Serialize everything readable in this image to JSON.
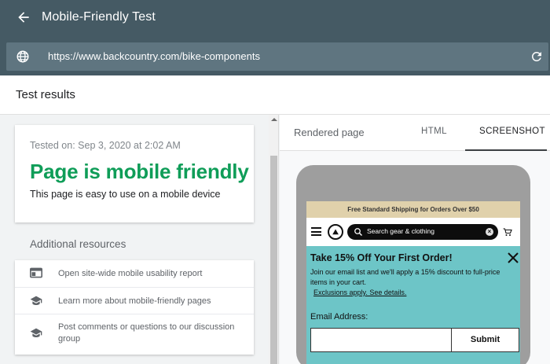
{
  "app": {
    "title": "Mobile-Friendly Test",
    "url": "https://www.backcountry.com/bike-components"
  },
  "results": {
    "header": "Test results",
    "tested_on": "Tested on: Sep 3, 2020 at 2:02 AM",
    "status": "Page is mobile friendly",
    "status_color": "#0f9d58",
    "subtitle": "This page is easy to use on a mobile device"
  },
  "resources": {
    "heading": "Additional resources",
    "items": [
      {
        "icon": "browser-window-icon",
        "label": "Open site-wide mobile usability report"
      },
      {
        "icon": "graduation-cap-icon",
        "label": "Learn more about mobile-friendly pages"
      },
      {
        "icon": "graduation-cap-icon",
        "label": "Post comments or questions to our discussion group"
      }
    ]
  },
  "tabs": {
    "rendered": "Rendered page",
    "html": "HTML",
    "screenshot": "SCREENSHOT",
    "active": "SCREENSHOT"
  },
  "preview": {
    "shipping_banner": "Free Standard Shipping for Orders Over $50",
    "search_placeholder": "Search gear & clothing",
    "promo_title": "Take 15% Off Your First Order!",
    "promo_body": "Join our email list and we'll apply a 15% discount to full-price items in your cart.",
    "promo_link": "Exclusions apply. See details.",
    "email_label": "Email Address:",
    "submit_label": "Submit",
    "promo_bg": "#6dc5c7",
    "banner_bg": "#e0d1ab"
  }
}
